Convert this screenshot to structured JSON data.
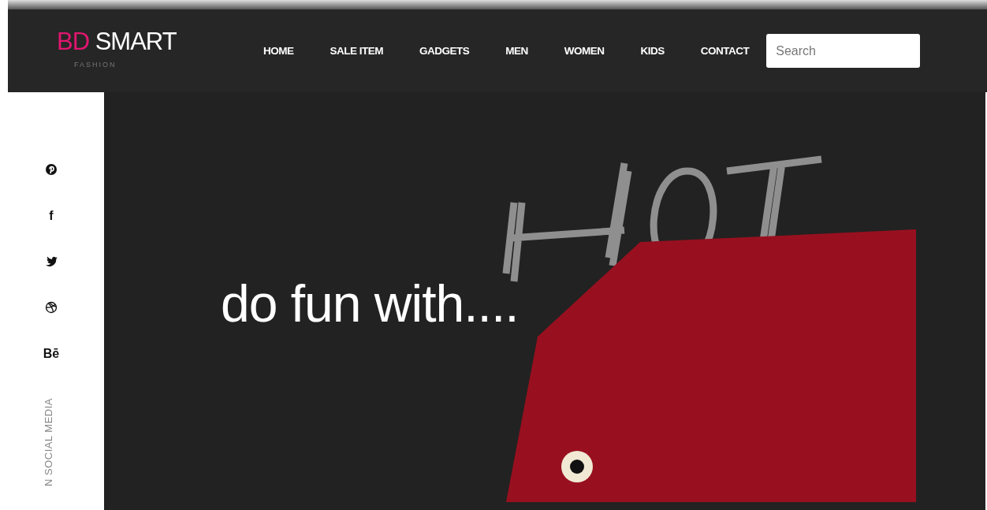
{
  "logo": {
    "accent": "BD",
    "name": "SMART",
    "tagline": "FASHION"
  },
  "nav": [
    {
      "label": "HOME"
    },
    {
      "label": "SALE ITEM"
    },
    {
      "label": "GADGETS"
    },
    {
      "label": "MEN"
    },
    {
      "label": "WOMEN"
    },
    {
      "label": "KIDS"
    },
    {
      "label": "CONTACT"
    }
  ],
  "search": {
    "placeholder": "Search"
  },
  "social": [
    {
      "kind": "pin"
    },
    {
      "kind": "text",
      "label": "f"
    },
    {
      "kind": "bird"
    },
    {
      "kind": "ball"
    },
    {
      "kind": "text",
      "label": "Bē"
    }
  ],
  "social_caption": "N SOCIAL MEDIA",
  "hero": {
    "headline": "do fun with...."
  }
}
